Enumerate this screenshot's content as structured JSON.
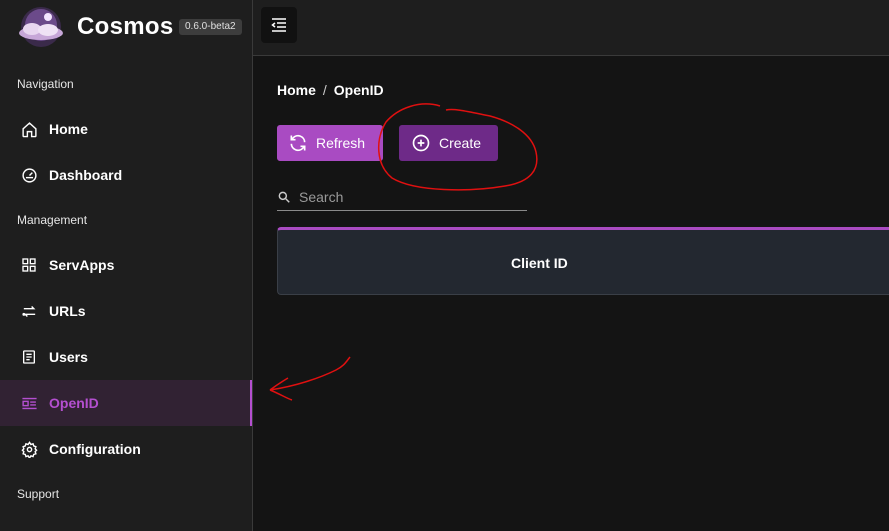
{
  "app": {
    "name": "Cosmos",
    "version": "0.6.0-beta2"
  },
  "sidebar": {
    "sections": [
      {
        "label": "Navigation"
      },
      {
        "label": "Management"
      },
      {
        "label": "Support"
      }
    ],
    "items": [
      {
        "label": "Home",
        "icon": "home-icon"
      },
      {
        "label": "Dashboard",
        "icon": "dashboard-icon"
      },
      {
        "label": "ServApps",
        "icon": "grid-icon"
      },
      {
        "label": "URLs",
        "icon": "urls-icon"
      },
      {
        "label": "Users",
        "icon": "users-icon"
      },
      {
        "label": "OpenID",
        "icon": "openid-icon",
        "active": true
      },
      {
        "label": "Configuration",
        "icon": "gear-icon"
      }
    ]
  },
  "breadcrumb": {
    "home": "Home",
    "separator": "/",
    "current": "OpenID"
  },
  "toolbar": {
    "refresh_label": "Refresh",
    "create_label": "Create"
  },
  "search": {
    "placeholder": "Search",
    "value": ""
  },
  "table": {
    "columns": [
      "Client ID"
    ]
  },
  "colors": {
    "accent": "#a94bc2",
    "create": "#6e2a88",
    "annotation": "#e01010"
  }
}
